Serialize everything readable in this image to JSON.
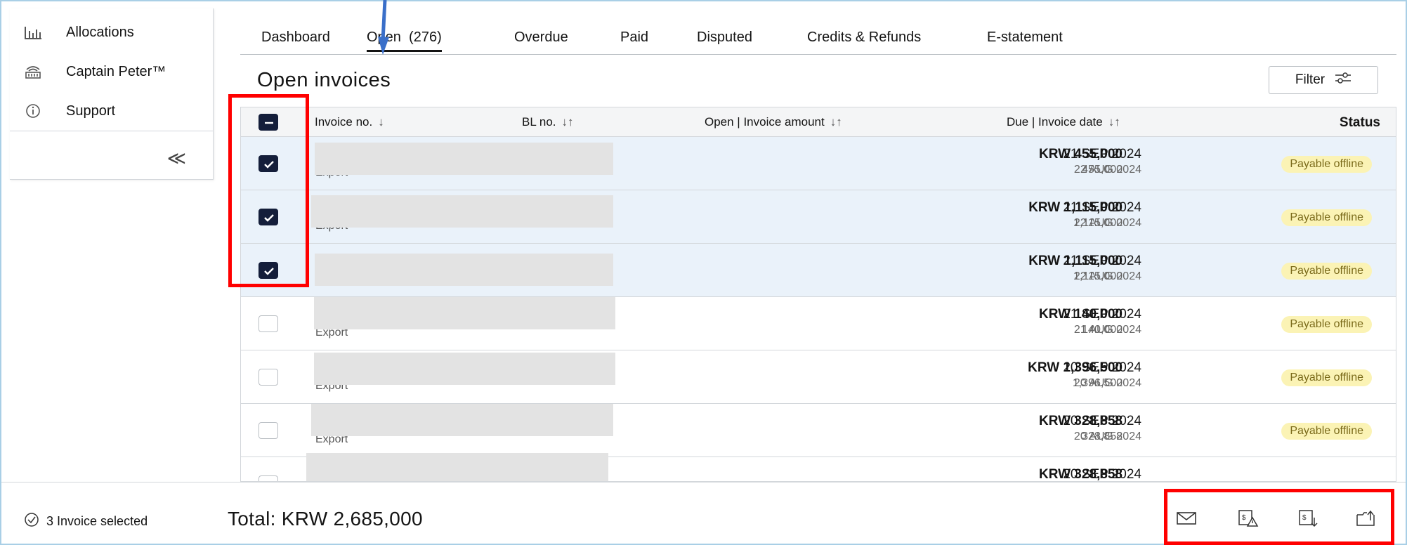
{
  "sidebar": {
    "items": [
      {
        "label": "Allocations",
        "icon": "bar-chart-icon"
      },
      {
        "label": "Captain Peter™",
        "icon": "robot-icon"
      },
      {
        "label": "Support",
        "icon": "info-icon"
      }
    ],
    "collapse_label": "≪"
  },
  "tabs": [
    {
      "label": "Dashboard"
    },
    {
      "label": "Open  (276)",
      "active": true
    },
    {
      "label": "Overdue"
    },
    {
      "label": "Paid"
    },
    {
      "label": "Disputed"
    },
    {
      "label": "Credits & Refunds"
    },
    {
      "label": "E-statement"
    }
  ],
  "page": {
    "title": "Open invoices",
    "filter_label": "Filter"
  },
  "table": {
    "headers": {
      "invoice_no": "Invoice no.",
      "bl_no": "BL no.",
      "amount": "Open | Invoice amount",
      "dates": "Due | Invoice date",
      "status": "Status"
    },
    "rows": [
      {
        "selected": true,
        "export_label": "Export",
        "amount": "KRW 455,000",
        "open_amount": "455,000",
        "due_date": "21 SEP 2024",
        "invoice_date": "22 AUG 2024",
        "status": "Payable offline"
      },
      {
        "selected": true,
        "export_label": "Export",
        "amount": "KRW 1,115,000",
        "open_amount": "1,115,000",
        "due_date": "21 SEP 2024",
        "invoice_date": "22 AUG 2024",
        "status": "Payable offline"
      },
      {
        "selected": true,
        "export_label": "",
        "amount": "KRW 1,115,000",
        "open_amount": "1,115,000",
        "due_date": "21 SEP 2024",
        "invoice_date": "22 AUG 2024",
        "status": "Payable offline"
      },
      {
        "selected": false,
        "export_label": "Export",
        "amount": "KRW 140,000",
        "open_amount": "140,000",
        "due_date": "21 SEP 2024",
        "invoice_date": "21 AUG 2024",
        "status": "Payable offline"
      },
      {
        "selected": false,
        "export_label": "Export",
        "amount": "KRW 1,396,500",
        "open_amount": "1,396,500",
        "due_date": "20 SEP 2024",
        "invoice_date": "20 AUG 2024",
        "status": "Payable offline"
      },
      {
        "selected": false,
        "export_label": "Export",
        "amount": "KRW 328,858",
        "open_amount": "328,858",
        "due_date": "20 SEP 2024",
        "invoice_date": "20 AUG 2024",
        "status": "Payable offline"
      },
      {
        "selected": false,
        "export_label": "",
        "amount": "KRW 328,858",
        "open_amount": "",
        "due_date": "20 SEP 2024",
        "invoice_date": "",
        "status": ""
      }
    ]
  },
  "footer": {
    "selected_text": "3 Invoice selected",
    "total_text": "Total: KRW 2,685,000",
    "actions": [
      "mail-icon",
      "dispute-icon",
      "download-invoice-icon",
      "share-icon"
    ]
  },
  "colors": {
    "selected_row_bg": "#eaf2fa",
    "checkbox_on": "#141e3a",
    "badge_bg": "#fbf3b5",
    "annotation_red": "#ff0000",
    "annotation_arrow": "#3a6fc9"
  }
}
